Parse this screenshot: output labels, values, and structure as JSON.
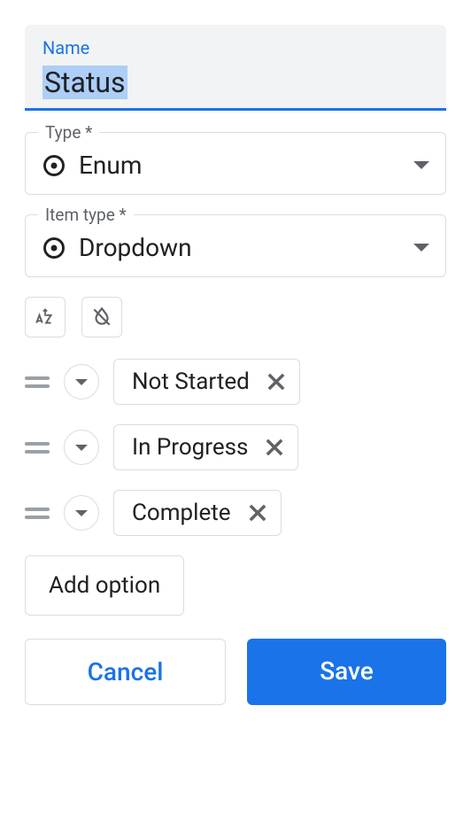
{
  "name_field": {
    "label": "Name",
    "value": "Status"
  },
  "type_field": {
    "label": "Type *",
    "value": "Enum"
  },
  "item_type_field": {
    "label": "Item type *",
    "value": "Dropdown"
  },
  "options": [
    {
      "label": "Not Started"
    },
    {
      "label": "In Progress"
    },
    {
      "label": "Complete"
    }
  ],
  "add_option_label": "Add option",
  "actions": {
    "cancel": "Cancel",
    "save": "Save"
  }
}
